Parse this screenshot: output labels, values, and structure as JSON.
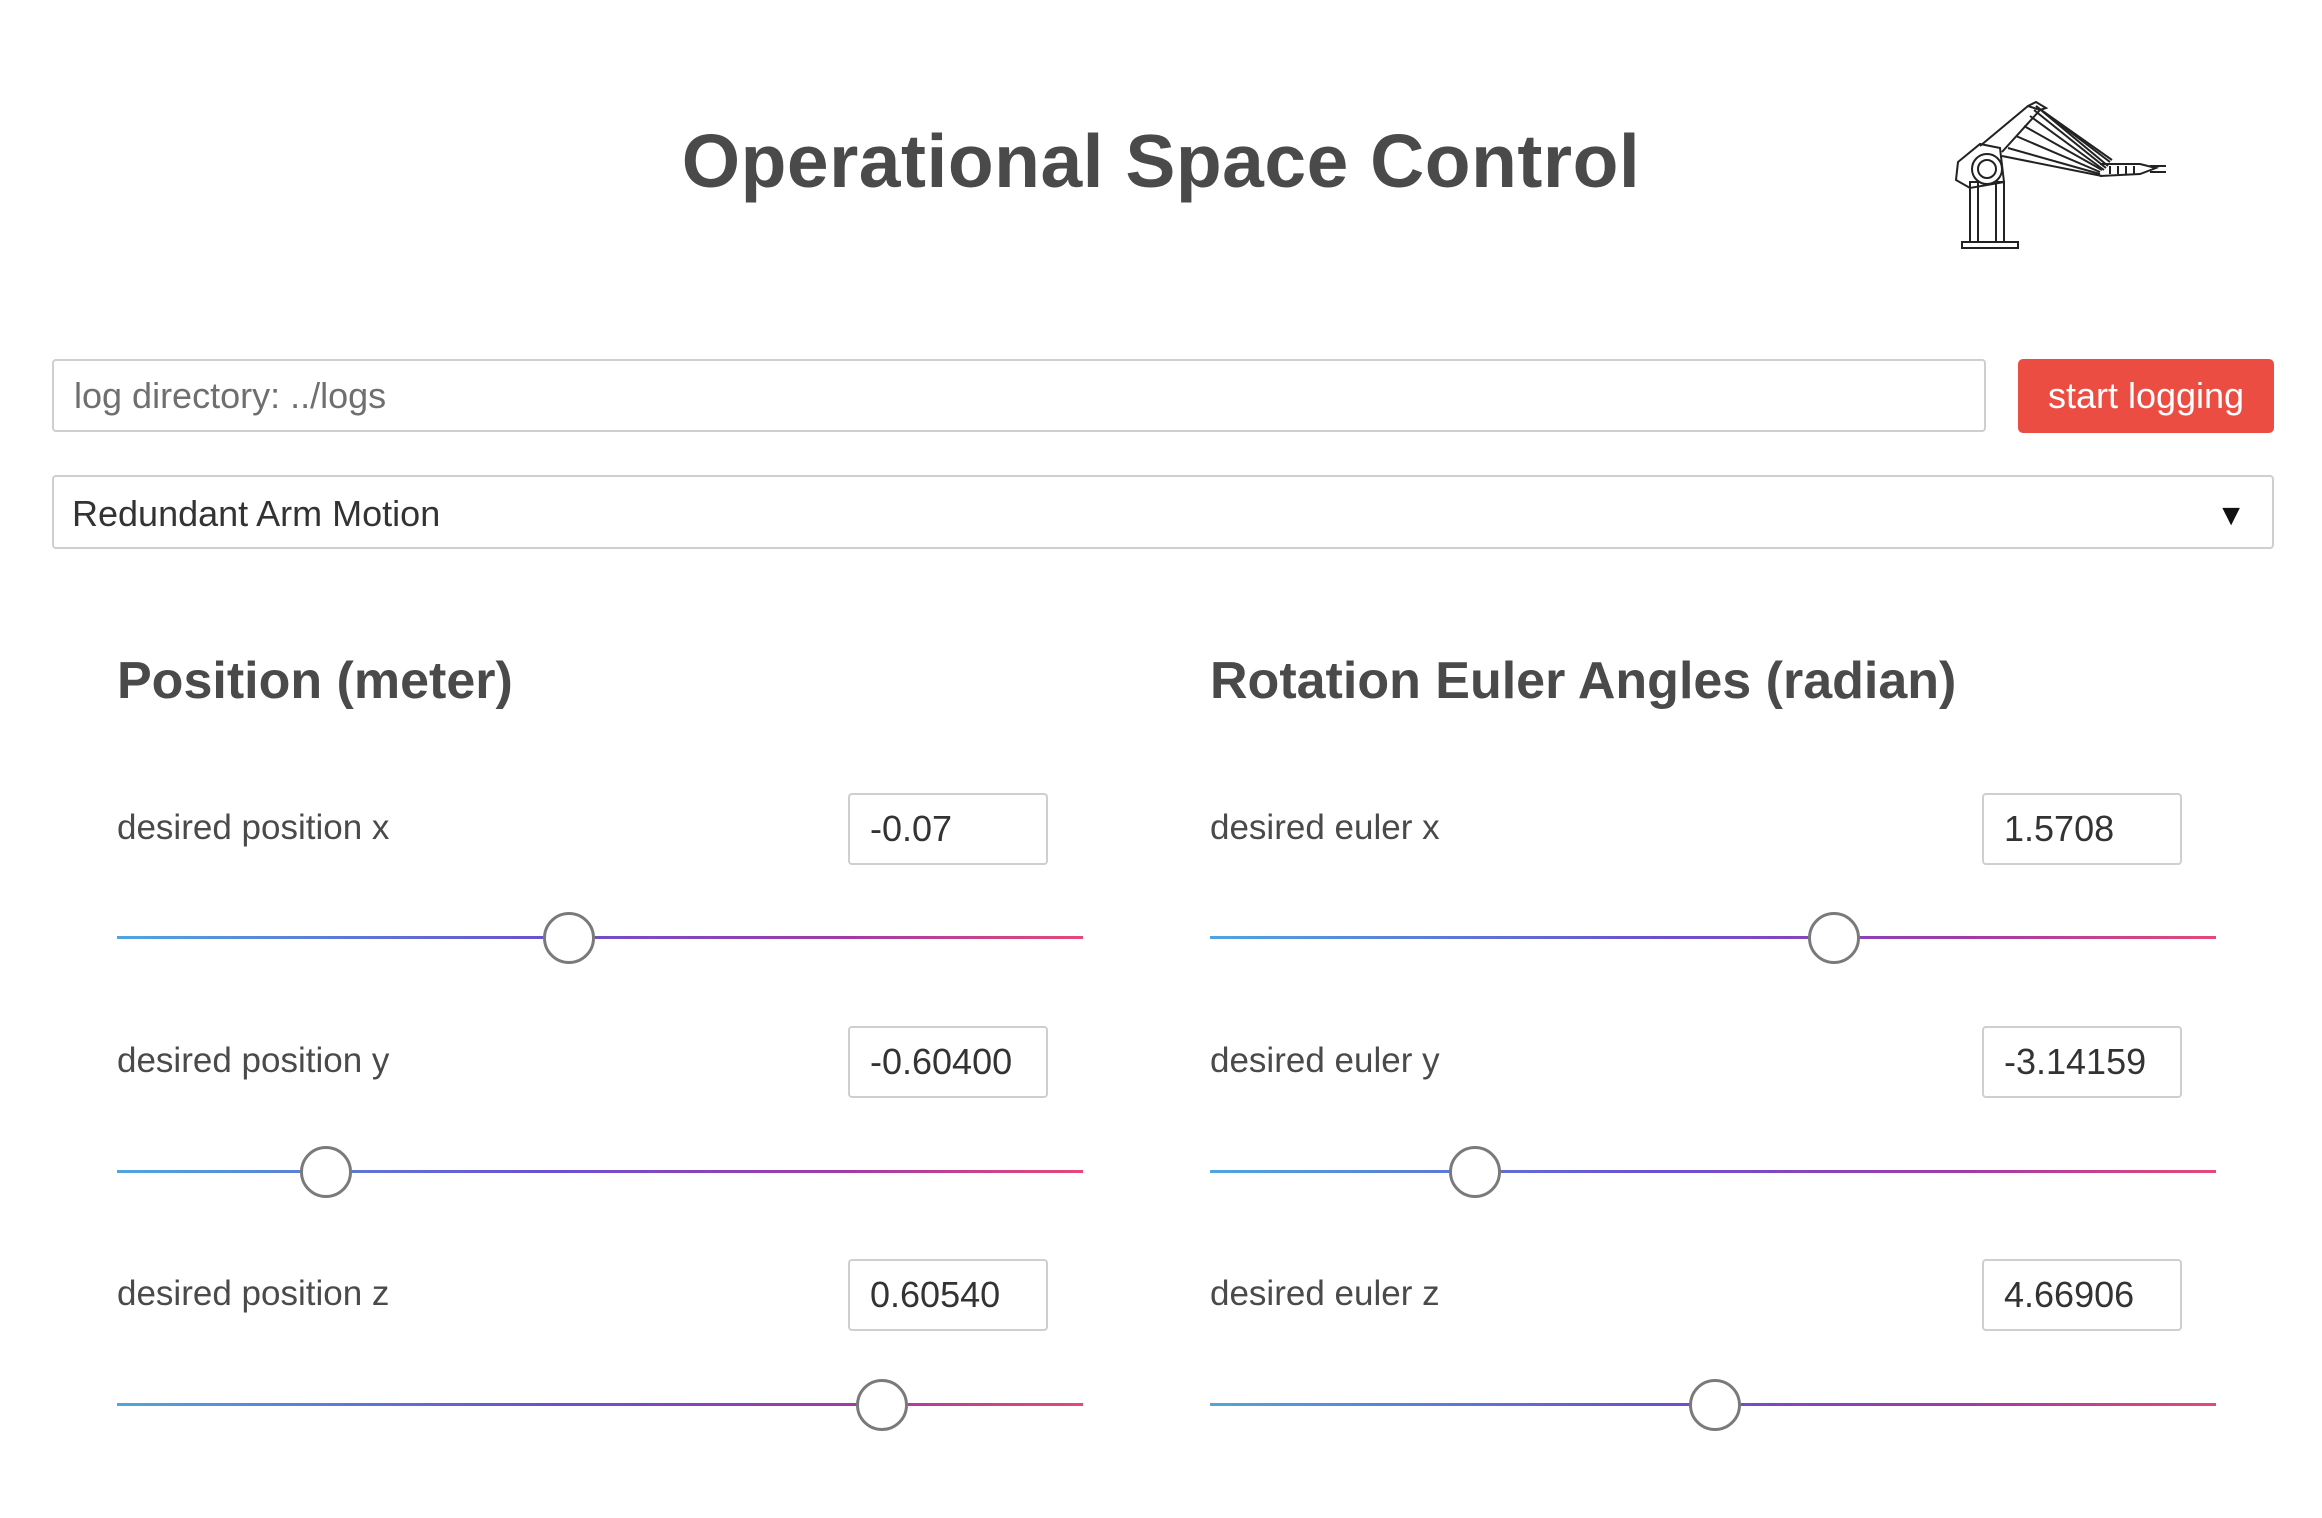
{
  "header": {
    "title": "Operational Space Control",
    "logo_icon": "robot-arm-icon"
  },
  "logging": {
    "directory_placeholder": "log directory: ../logs",
    "directory_value": "",
    "start_label": "start logging",
    "start_color": "#ec4d43"
  },
  "mode_select": {
    "selected": "Redundant Arm Motion",
    "arrow": "▼"
  },
  "position": {
    "title": "Position (meter)",
    "rows": [
      {
        "label": "desired position x",
        "value": "-0.07",
        "slider_fraction": 0.467
      },
      {
        "label": "desired position y",
        "value": "-0.60400",
        "slider_fraction": 0.215
      },
      {
        "label": "desired position z",
        "value": "0.60540",
        "slider_fraction": 0.791
      }
    ]
  },
  "rotation": {
    "title": "Rotation Euler Angles (radian)",
    "rows": [
      {
        "label": "desired euler x",
        "value": "1.5708",
        "slider_fraction": 0.619
      },
      {
        "label": "desired euler y",
        "value": "-3.14159",
        "slider_fraction": 0.262
      },
      {
        "label": "desired euler z",
        "value": "4.66906",
        "slider_fraction": 0.501
      }
    ]
  },
  "slider_gradient": [
    "#4ea6de",
    "#6b4fd0",
    "#a03aa8",
    "#e64877"
  ]
}
